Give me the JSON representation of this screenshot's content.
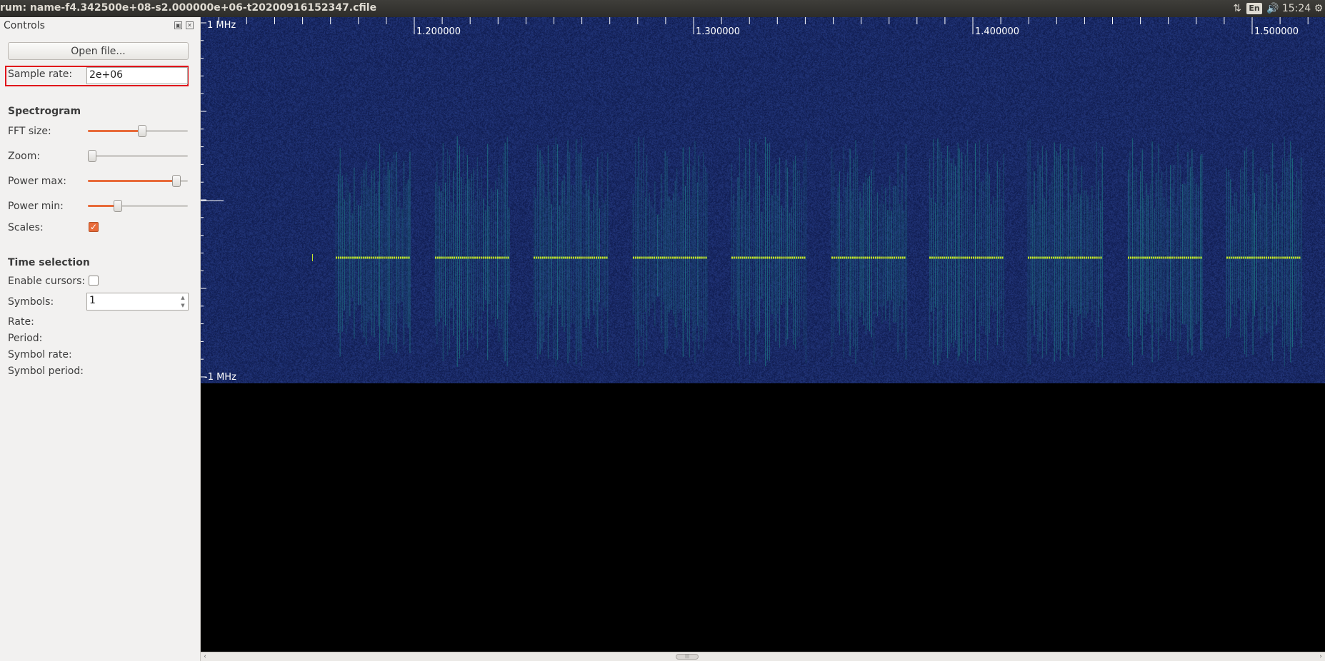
{
  "window": {
    "title": "rum: name-f4.342500e+08-s2.000000e+06-t20200916152347.cfile"
  },
  "tray": {
    "network_icon": "network-updown-icon",
    "language": "En",
    "volume_icon": "volume-icon",
    "time": "15:24",
    "settings_icon": "gear-icon"
  },
  "controls": {
    "title": "Controls",
    "open_file_label": "Open file...",
    "sample_rate_label": "Sample rate:",
    "sample_rate_value": "2e+06",
    "spectrogram_heading": "Spectrogram",
    "fft_size_label": "FFT size:",
    "fft_size_level": 0.55,
    "zoom_label": "Zoom:",
    "zoom_level": 0.0,
    "power_max_label": "Power max:",
    "power_max_level": 0.92,
    "power_min_label": "Power min:",
    "power_min_level": 0.28,
    "scales_label": "Scales:",
    "scales_checked": true,
    "time_selection_heading": "Time selection",
    "enable_cursors_label": "Enable cursors:",
    "enable_cursors_checked": false,
    "symbols_label": "Symbols:",
    "symbols_value": "1",
    "rate_label": "Rate:",
    "period_label": "Period:",
    "symbol_rate_label": "Symbol rate:",
    "symbol_period_label": "Symbol period:"
  },
  "spectrogram": {
    "freq_top_label": "1 MHz",
    "freq_bottom_label": "-1 MHz",
    "time_ticks": [
      "1.200000",
      "1.300000",
      "1.400000",
      "1.500000"
    ],
    "colors": {
      "background": "#142257",
      "signal": "#c6e82a",
      "spread": "#1f8a8a"
    }
  }
}
